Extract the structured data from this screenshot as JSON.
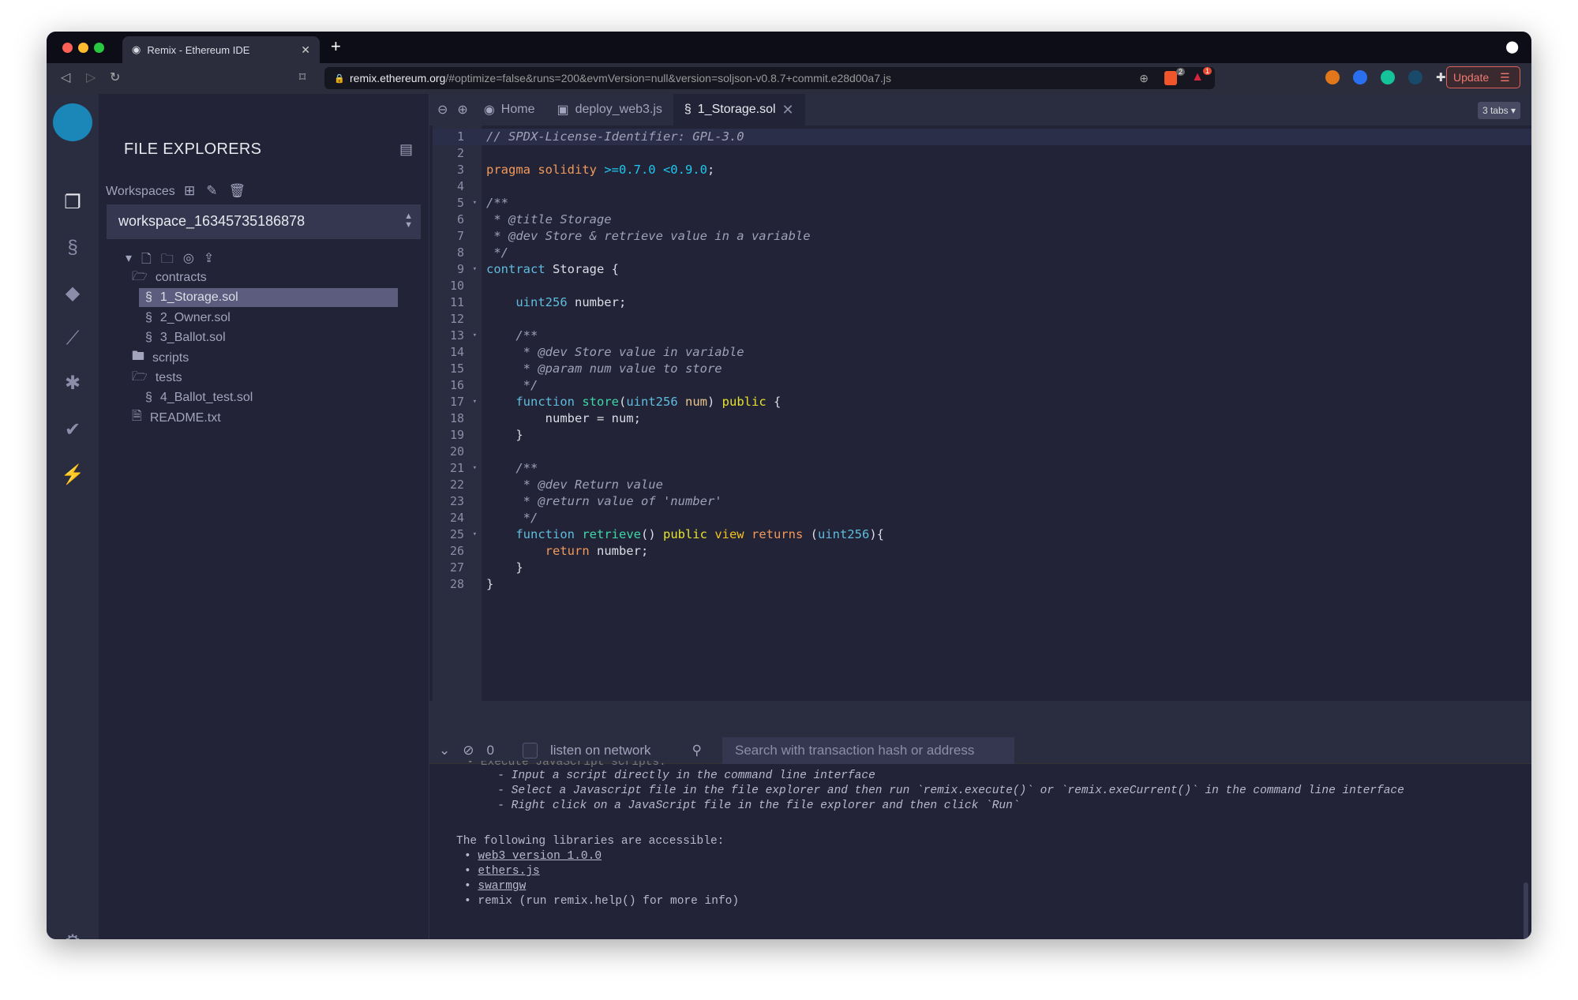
{
  "browser": {
    "tab_title": "Remix - Ethereum IDE",
    "url_host": "remix.ethereum.org",
    "url_rest": "/#optimize=false&runs=200&evmVersion=null&version=soljson-v0.8.7+commit.e28d00a7.js",
    "update_label": "Update",
    "brave_badge": "2",
    "rewards_badge": "1"
  },
  "sidebar": {
    "title": "FILE EXPLORERS",
    "workspaces_label": "Workspaces",
    "workspace": "workspace_16345735186878",
    "tree": [
      {
        "name": "contracts",
        "type": "folder-open",
        "depth": 0
      },
      {
        "name": "1_Storage.sol",
        "type": "sol",
        "depth": 1,
        "selected": true
      },
      {
        "name": "2_Owner.sol",
        "type": "sol",
        "depth": 1
      },
      {
        "name": "3_Ballot.sol",
        "type": "sol",
        "depth": 1
      },
      {
        "name": "scripts",
        "type": "folder",
        "depth": 0
      },
      {
        "name": "tests",
        "type": "folder-open",
        "depth": 0
      },
      {
        "name": "4_Ballot_test.sol",
        "type": "sol",
        "depth": 1
      },
      {
        "name": "README.txt",
        "type": "file",
        "depth": 0
      }
    ]
  },
  "editor": {
    "tabs": [
      {
        "label": "Home",
        "icon": "remix-icon"
      },
      {
        "label": "deploy_web3.js",
        "icon": "js-file-icon"
      },
      {
        "label": "1_Storage.sol",
        "icon": "solidity-icon",
        "active": true
      }
    ],
    "tabs_count": "3 tabs",
    "lines": [
      [
        [
          "// SPDX-License-Identifier: GPL-3.0",
          "c"
        ]
      ],
      [],
      [
        [
          "pragma solidity ",
          "k"
        ],
        [
          ">=0.7.0 <0.9.0",
          "n"
        ],
        [
          ";",
          ""
        ]
      ],
      [],
      [
        [
          "/**",
          "c"
        ]
      ],
      [
        [
          " * @title Storage",
          "c"
        ]
      ],
      [
        [
          " * @dev Store & retrieve value in a variable",
          "c"
        ]
      ],
      [
        [
          " */",
          "c"
        ]
      ],
      [
        [
          "contract ",
          "t"
        ],
        [
          "Storage {",
          ""
        ]
      ],
      [],
      [
        [
          "    uint256 ",
          "t"
        ],
        [
          "number;",
          ""
        ]
      ],
      [],
      [
        [
          "    /**",
          "c"
        ]
      ],
      [
        [
          "     * @dev Store value in variable",
          "c"
        ]
      ],
      [
        [
          "     * @param num value to store",
          "c"
        ]
      ],
      [
        [
          "     */",
          "c"
        ]
      ],
      [
        [
          "    function ",
          "t"
        ],
        [
          "store",
          "fn"
        ],
        [
          "(",
          ""
        ],
        [
          "uint256 ",
          "t"
        ],
        [
          "num",
          "p"
        ],
        [
          ") ",
          ""
        ],
        [
          "public ",
          "y"
        ],
        [
          "{",
          ""
        ]
      ],
      [
        [
          "        number = num;",
          ""
        ]
      ],
      [
        [
          "    }",
          ""
        ]
      ],
      [],
      [
        [
          "    /**",
          "c"
        ]
      ],
      [
        [
          "     * @dev Return value",
          "c"
        ]
      ],
      [
        [
          "     * @return value of 'number'",
          "c"
        ]
      ],
      [
        [
          "     */",
          "c"
        ]
      ],
      [
        [
          "    function ",
          "t"
        ],
        [
          "retrieve",
          "fn"
        ],
        [
          "() ",
          ""
        ],
        [
          "public ",
          "y"
        ],
        [
          "view ",
          "v"
        ],
        [
          "returns ",
          "k"
        ],
        [
          "(",
          ""
        ],
        [
          "uint256",
          "t"
        ],
        [
          "){",
          ""
        ]
      ],
      [
        [
          "        return ",
          "k"
        ],
        [
          "number;",
          ""
        ]
      ],
      [
        [
          "    }",
          ""
        ]
      ],
      [
        [
          "}",
          ""
        ]
      ]
    ],
    "folds": [
      5,
      9,
      13,
      17,
      21,
      25
    ]
  },
  "terminal": {
    "count": "0",
    "listen_label": "listen on network",
    "search_placeholder": "Search with transaction hash or address",
    "lines": [
      "  • Execute JavaScript scripts:",
      "      - Input a script directly in the command line interface",
      "      - Select a Javascript file in the file explorer and then run `remix.execute()` or `remix.exeCurrent()` in the command line interface",
      "      - Right click on a JavaScript file in the file explorer and then click `Run`"
    ],
    "libs_heading": "The following libraries are accessible:",
    "libs": [
      "web3 version 1.0.0",
      "ethers.js",
      "swarmgw"
    ],
    "libs_last": "remix (run remix.help() for more info)",
    "prompt": ">"
  }
}
